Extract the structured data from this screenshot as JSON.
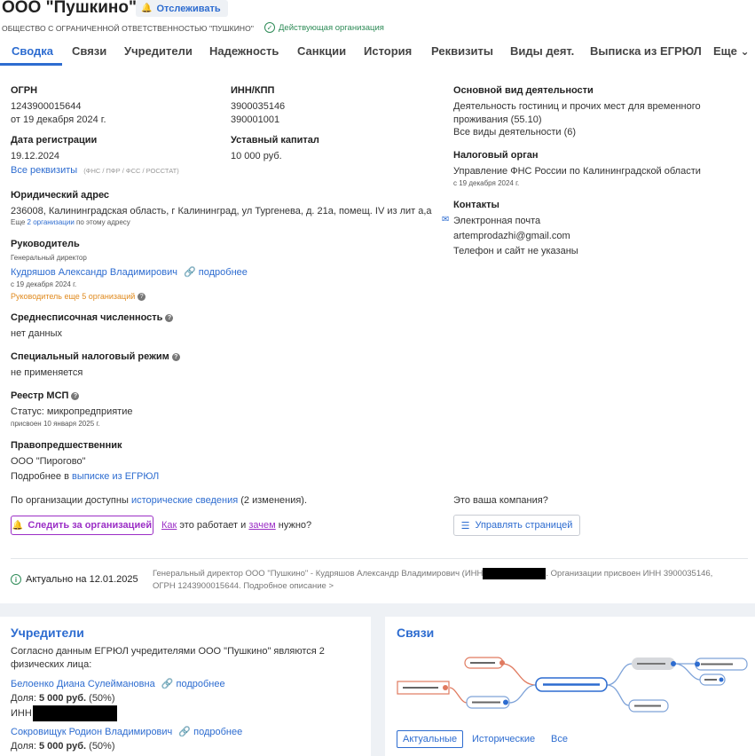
{
  "header": {
    "title": "ООО \"Пушкино\"",
    "track_label": "Отслеживать",
    "full_name": "ОБЩЕСТВО С ОГРАНИЧЕННОЙ ОТВЕТСТВЕННОСТЬЮ \"ПУШКИНО\"",
    "status": "Действующая организация"
  },
  "tabs": [
    "Сводка",
    "Связи",
    "Учредители",
    "Надежность",
    "Санкции",
    "История",
    "Реквизиты",
    "Виды деят.",
    "Выписка из ЕГРЮЛ",
    "Еще"
  ],
  "summary": {
    "ogrn_label": "ОГРН",
    "ogrn": "1243900015644",
    "ogrn_date": "от 19 декабря 2024 г.",
    "inn_label": "ИНН/КПП",
    "inn": "3900035146",
    "kpp": "390001001",
    "reg_label": "Дата регистрации",
    "reg_date": "19.12.2024",
    "all_requisites": "Все реквизиты",
    "requisites_note": "(ФНС / ПФР / ФСС / РОССТАТ)",
    "capital_label": "Уставный капитал",
    "capital": "10 000 руб.",
    "activity_label": "Основной вид деятельности",
    "activity_line1": "Деятельность гостиниц и прочих мест для временного",
    "activity_line2": "проживания",
    "activity_code": "(55.10)",
    "all_activities": "Все виды деятельности (6)",
    "tax_label": "Налоговый орган",
    "tax_value": "Управление ФНС России по Калининградской области",
    "tax_date": "с 19 декабря 2024 г.",
    "contacts_label": "Контакты",
    "email_label": "Электронная почта",
    "email": "artemprodazhi@gmail.com",
    "phone_note": "Телефон и сайт не указаны",
    "address_label": "Юридический адрес",
    "address": "236008, Калининградская область, г Калининград, ул Тургенева, д. 21а, помещ. IV из лит а,а",
    "address_more_pre": "Еще",
    "address_more_link": "2 организации",
    "address_more_post": "по этому адресу",
    "head_label": "Руководитель",
    "head_role": "Генеральный директор",
    "head_name": "Кудряшов Александр Владимирович",
    "more_label": "подробнее",
    "head_date": "с 19 декабря 2024 г.",
    "head_other": "Руководитель еще 5 организаций",
    "staff_label": "Среднесписочная численность",
    "staff_value": "нет данных",
    "taxmode_label": "Специальный налоговый режим",
    "taxmode_value": "не применяется",
    "msp_label": "Реестр МСП",
    "msp_value": "Статус: микропредприятие",
    "msp_date": "присвоен 10 января 2025 г.",
    "pred_label": "Правопредшественник",
    "pred_name": "ООО \"Пирогово\"",
    "pred_more_pre": "Подробнее в",
    "pred_more_link": "выписке из ЕГРЮЛ",
    "history_pre": "По организации доступны",
    "history_link": "исторические сведения",
    "history_post": "(2 изменения).",
    "your_company": "Это ваша компания?",
    "follow_btn": "Следить за организацией",
    "how_pre": "Как",
    "how_mid": "это работает и",
    "why": "зачем",
    "how_post": "нужно?",
    "manage_btn": "Управлять страницей",
    "actual_label": "Актуально на 12.01.2025",
    "desc_pre": "Генеральный директор ООО \"Пушкино\" - Кудряшов Александр Владимирович (ИНН",
    "desc_post": ". Организации присвоен ИНН 3900035146,",
    "desc_line2": "ОГРН 1243900015644. Подробное описание >"
  },
  "founders": {
    "title": "Учредители",
    "intro1": "Согласно данным ЕГРЮЛ учредителями ООО \"Пушкино\" являются 2",
    "intro2": "физических лица:",
    "f1_name": "Белоенко Диана Сулеймановна",
    "share_label": "Доля:",
    "f1_share": "5 000 руб.",
    "f1_pct": "(50%)",
    "inn_label": "ИНН",
    "f2_name": "Сокровищук Родион Владимирович",
    "f2_share": "5 000 руб.",
    "f2_pct": "(50%)",
    "more_label": "подробнее"
  },
  "links": {
    "title": "Связи",
    "tabs": [
      "Актуальные",
      "Исторические",
      "Все"
    ]
  }
}
